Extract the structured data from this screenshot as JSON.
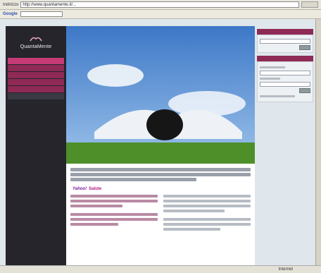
{
  "browser": {
    "address_label": "Indirizzo",
    "address_url": "http://www.quantamente.it/...",
    "go_label": "",
    "toolbar_brand": "Google",
    "toolbar_buttons": [
      "",
      ""
    ]
  },
  "site": {
    "brand_name": "QuantaMente",
    "nav": [
      "",
      "",
      "",
      "",
      "",
      ""
    ],
    "news_source_brand": "Yahoo!",
    "news_source_section": "Salute",
    "left_column_title": "",
    "right_column_title": ""
  },
  "status": {
    "zone": "Internet"
  },
  "colors": {
    "nav_bg": "#25252b",
    "nav_item": "#8e2a55",
    "nav_item_active": "#c63b76",
    "accent": "#b0178a"
  }
}
